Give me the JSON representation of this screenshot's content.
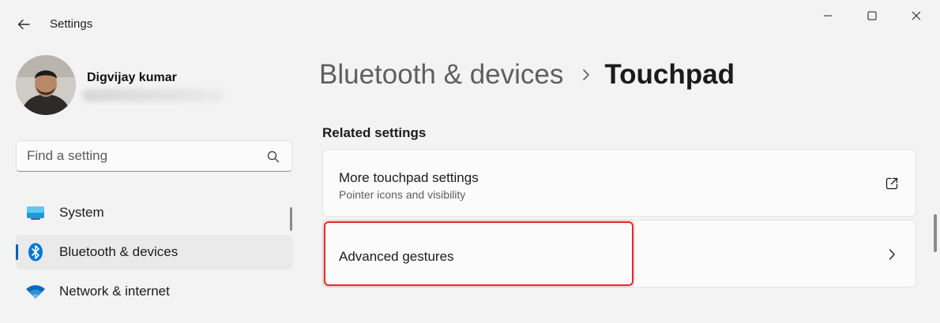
{
  "window": {
    "title": "Settings"
  },
  "profile": {
    "name": "Digvijay kumar"
  },
  "search": {
    "placeholder": "Find a setting"
  },
  "sidebar": {
    "items": [
      {
        "label": "System",
        "icon": "monitor-icon",
        "active": false
      },
      {
        "label": "Bluetooth & devices",
        "icon": "bluetooth-icon",
        "active": true
      },
      {
        "label": "Network & internet",
        "icon": "wifi-icon",
        "active": false
      }
    ]
  },
  "breadcrumb": {
    "parent": "Bluetooth & devices",
    "current": "Touchpad"
  },
  "related": {
    "title": "Related settings",
    "cards": [
      {
        "title": "More touchpad settings",
        "subtitle": "Pointer icons and visibility",
        "icon": "external-link-icon"
      },
      {
        "title": "Advanced gestures",
        "icon": "chevron-right-icon",
        "highlighted": true
      }
    ]
  },
  "colors": {
    "accent": "#005fb8",
    "highlight": "#e12c2c",
    "background": "#f3f3f3",
    "card": "#fbfbfb"
  }
}
